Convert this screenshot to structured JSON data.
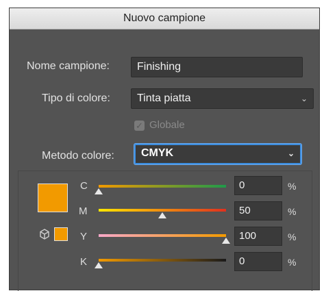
{
  "window": {
    "title": "Nuovo campione"
  },
  "form": {
    "name_label": "Nome campione:",
    "name_value": "Finishing",
    "type_label": "Tipo di colore:",
    "type_value": "Tinta piatta",
    "global_label": "Globale",
    "global_checked": true,
    "mode_label": "Metodo colore:",
    "mode_value": "CMYK"
  },
  "swatch": {
    "color": "#f29a00"
  },
  "channels": [
    {
      "label": "C",
      "value": "0",
      "unit": "%",
      "percent": 0,
      "gradient": [
        "#f29a00",
        "#1f9a4a"
      ]
    },
    {
      "label": "M",
      "value": "50",
      "unit": "%",
      "percent": 50,
      "gradient": [
        "#ffe600",
        "#e0301e"
      ]
    },
    {
      "label": "Y",
      "value": "100",
      "unit": "%",
      "percent": 100,
      "gradient": [
        "#f7a8c8",
        "#f29a00"
      ]
    },
    {
      "label": "K",
      "value": "0",
      "unit": "%",
      "percent": 0,
      "gradient": [
        "#f29a00",
        "#1a1a1a"
      ]
    }
  ],
  "icons": {
    "dropdown": "chevron-down-icon",
    "cube": "cube-icon",
    "check": "checkmark-icon"
  }
}
